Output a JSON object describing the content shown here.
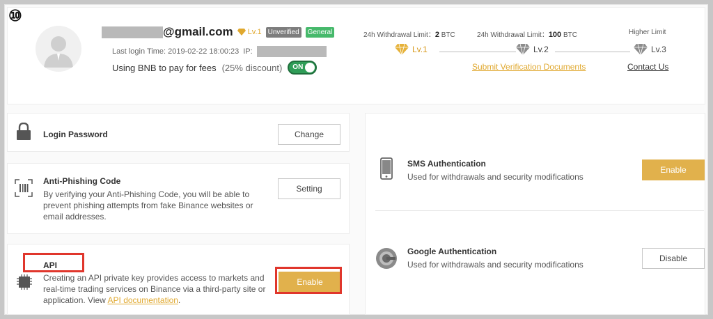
{
  "step_marker": "⑩",
  "profile": {
    "email_suffix": "@gmail.com",
    "level_badge": "Lv.1",
    "unverified_tag": "Unverified",
    "general_tag": "General",
    "last_login_label": "Last login Time: 2019-02-22 18:00:23",
    "ip_label": "IP:",
    "bnb_label": "Using BNB to pay for fees",
    "bnb_discount": "(25% discount)",
    "bnb_toggle": "ON"
  },
  "limits": {
    "lv1_prefix": "24h Withdrawal Limit：",
    "lv1_amount": "2",
    "lv1_unit": "BTC",
    "lv2_prefix": "24h Withdrawal Limit：",
    "lv2_amount": "100",
    "lv2_unit": "BTC",
    "lv3": "Higher Limit",
    "levels": [
      "Lv.1",
      "Lv.2",
      "Lv.3"
    ],
    "submit_link": "Submit Verification Documents",
    "contact_link": "Contact Us"
  },
  "security": {
    "login_password": {
      "title": "Login Password",
      "button": "Change"
    },
    "anti_phishing": {
      "title": "Anti-Phishing Code",
      "desc": "By verifying your Anti-Phishing Code, you will be able to prevent phishing attempts from fake Binance websites or email addresses.",
      "button": "Setting"
    },
    "api": {
      "title": "API",
      "desc": "Creating an API private key provides access to markets and real-time trading services on Binance via a third-party site or application. View",
      "link": "API documentation",
      "link_suffix": ".",
      "button": "Enable"
    },
    "sms": {
      "title": "SMS Authentication",
      "desc": "Used for withdrawals and security modifications",
      "button": "Enable"
    },
    "google": {
      "title": "Google Authentication",
      "desc": "Used for withdrawals and security modifications",
      "button": "Disable"
    }
  },
  "colors": {
    "gold": "#e1b14c",
    "highlight": "#e0362c",
    "toggle_green": "#2f9d57"
  }
}
